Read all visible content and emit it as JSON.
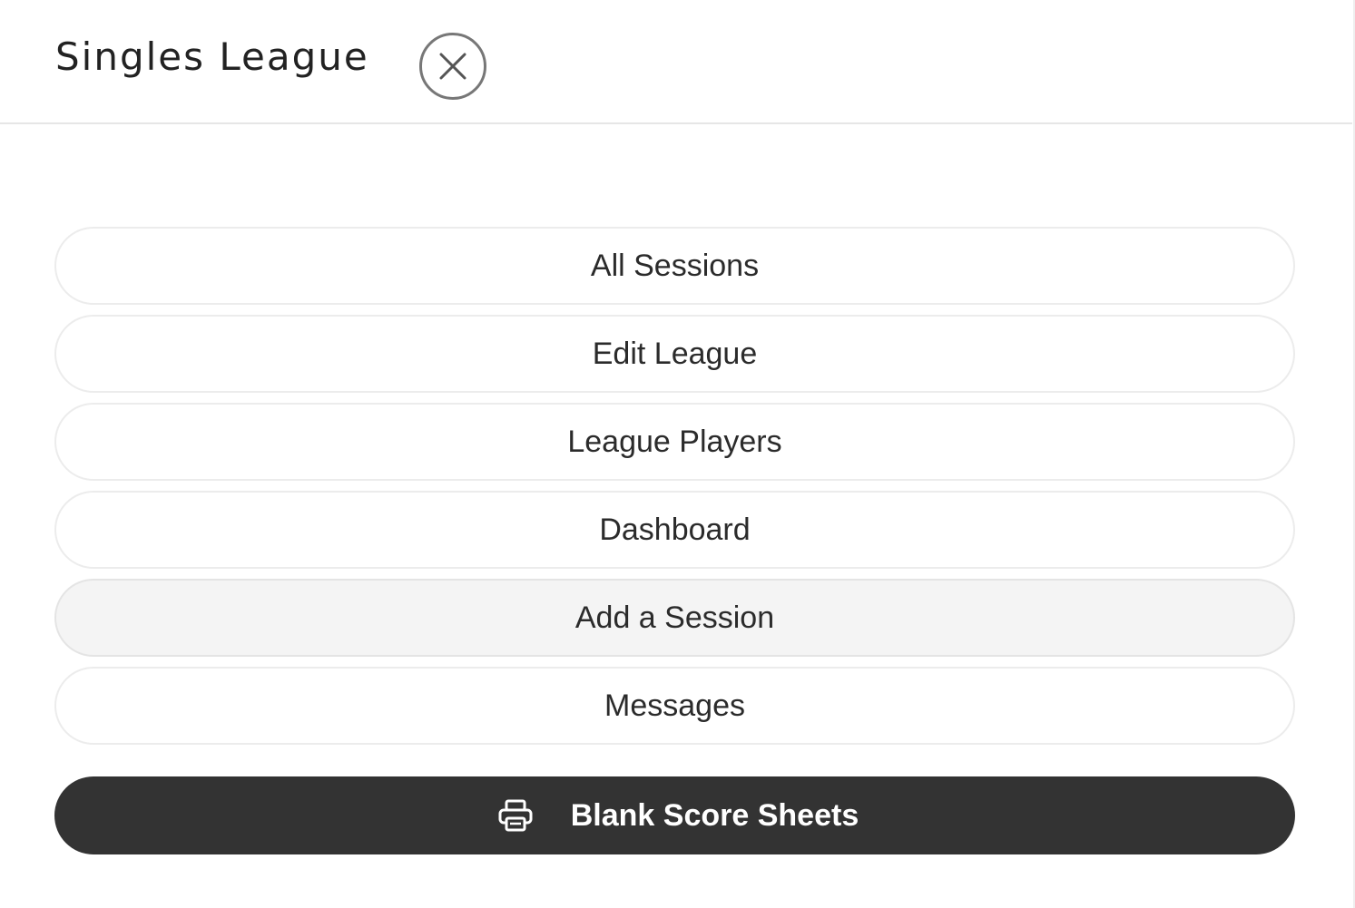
{
  "header": {
    "title": "Singles League",
    "close_icon": "close-icon"
  },
  "menu": {
    "items": [
      {
        "label": "All Sessions",
        "highlighted": false
      },
      {
        "label": "Edit League",
        "highlighted": false
      },
      {
        "label": "League Players",
        "highlighted": false
      },
      {
        "label": "Dashboard",
        "highlighted": false
      },
      {
        "label": "Add a Session",
        "highlighted": true
      },
      {
        "label": "Messages",
        "highlighted": false
      }
    ]
  },
  "print_button": {
    "label": "Blank Score Sheets",
    "icon": "printer-icon",
    "background": "#333333",
    "text_color": "#ffffff"
  },
  "colors": {
    "item_border": "#ececec",
    "highlight_background": "#f4f4f4",
    "text": "#2b2b2b"
  }
}
